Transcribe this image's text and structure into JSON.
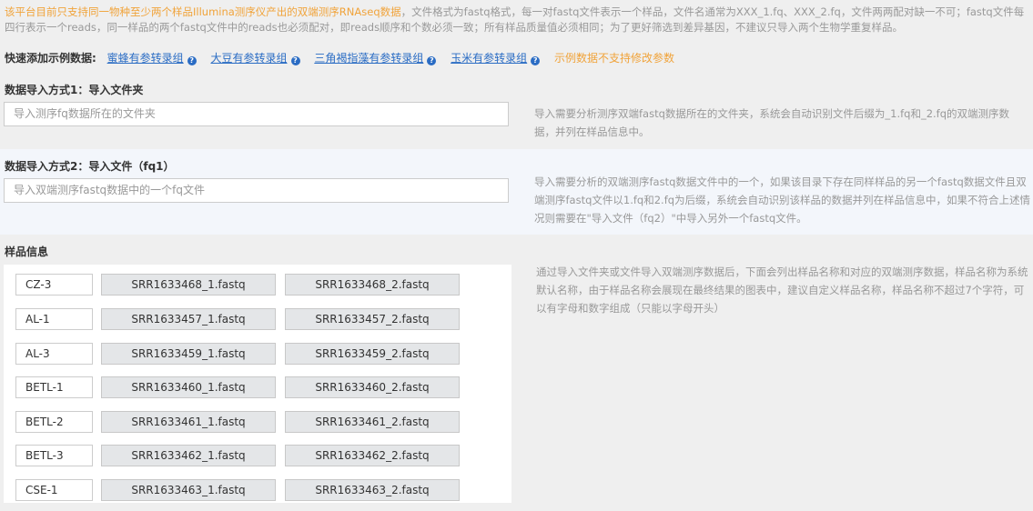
{
  "notice": {
    "highlight": "该平台目前只支持同一物种至少两个样品Illumina测序仪产出的双端测序RNAseq数据",
    "rest": "，文件格式为fastq格式，每一对fastq文件表示一个样品，文件名通常为XXX_1.fq、XXX_2.fq，文件两两配对缺一不可；fastq文件每四行表示一个reads，同一样品的两个fastq文件中的reads也必须配对，即reads顺序和个数必须一致；所有样品质量值必须相同；为了更好筛选到差异基因，不建议只导入两个生物学重复样品。"
  },
  "quick": {
    "label": "快速添加示例数据:",
    "links": [
      {
        "label": "蜜蜂有参转录组"
      },
      {
        "label": "大豆有参转录组"
      },
      {
        "label": "三角褐指藻有参转录组"
      },
      {
        "label": "玉米有参转录组"
      }
    ],
    "warning": "示例数据不支持修改参数"
  },
  "method1": {
    "title": "数据导入方式1：导入文件夹",
    "placeholder": "导入测序fq数据所在的文件夹",
    "help": "导入需要分析测序双端fastq数据所在的文件夹，系统会自动识别文件后缀为_1.fq和_2.fq的双端测序数据，并列在样品信息中。"
  },
  "method2": {
    "title": "数据导入方式2：导入文件（fq1）",
    "placeholder": "导入双端测序fastq数据中的一个fq文件",
    "help": "导入需要分析的双端测序fastq数据文件中的一个，如果该目录下存在同样样品的另一个fastq数据文件且双端测序fastq文件以1.fq和2.fq为后缀，系统会自动识别该样品的数据并列在样品信息中，如果不符合上述情况则需要在\"导入文件（fq2）\"中导入另外一个fastq文件。"
  },
  "samples": {
    "title": "样品信息",
    "help": "通过导入文件夹或文件导入双端测序数据后，下面会列出样品名称和对应的双端测序数据，样品名称为系统默认名称，由于样品名称会展现在最终结果的图表中，建议自定义样品名称，样品名称不超过7个字符，可以有字母和数字组成（只能以字母开头）",
    "rows": [
      {
        "name": "CZ-3",
        "fq1": "SRR1633468_1.fastq",
        "fq2": "SRR1633468_2.fastq"
      },
      {
        "name": "AL-1",
        "fq1": "SRR1633457_1.fastq",
        "fq2": "SRR1633457_2.fastq"
      },
      {
        "name": "AL-3",
        "fq1": "SRR1633459_1.fastq",
        "fq2": "SRR1633459_2.fastq"
      },
      {
        "name": "BETL-1",
        "fq1": "SRR1633460_1.fastq",
        "fq2": "SRR1633460_2.fastq"
      },
      {
        "name": "BETL-2",
        "fq1": "SRR1633461_1.fastq",
        "fq2": "SRR1633461_2.fastq"
      },
      {
        "name": "BETL-3",
        "fq1": "SRR1633462_1.fastq",
        "fq2": "SRR1633462_2.fastq"
      },
      {
        "name": "CSE-1",
        "fq1": "SRR1633463_1.fastq",
        "fq2": "SRR1633463_2.fastq"
      }
    ]
  },
  "colors": {
    "accent": "#f0a33a",
    "link": "#2a6cc4"
  }
}
